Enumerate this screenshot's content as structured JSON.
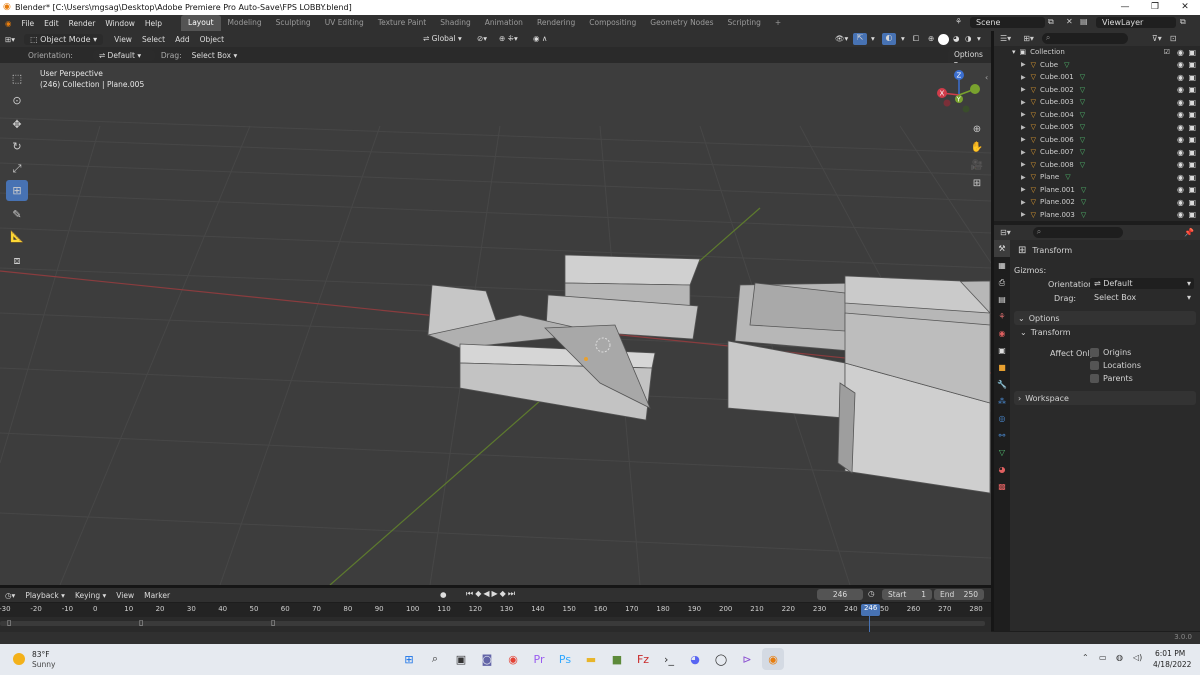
{
  "window": {
    "title": "Blender* [C:\\Users\\mgsag\\Desktop\\Adobe Premiere Pro Auto-Save\\FPS LOBBY.blend]"
  },
  "menu": {
    "items": [
      "File",
      "Edit",
      "Render",
      "Window",
      "Help"
    ]
  },
  "workspaces": [
    "Layout",
    "Modeling",
    "Sculpting",
    "UV Editing",
    "Texture Paint",
    "Shading",
    "Animation",
    "Rendering",
    "Compositing",
    "Geometry Nodes",
    "Scripting"
  ],
  "scene": {
    "label": "Scene",
    "view_layer": "ViewLayer"
  },
  "viewport_header": {
    "mode": "Object Mode",
    "view": "View",
    "select": "Select",
    "add": "Add",
    "object": "Object",
    "transform": "Global",
    "options": "Options"
  },
  "tool_header": {
    "orientation_label": "Orientation:",
    "orientation_value": "Default",
    "drag_label": "Drag:",
    "drag_value": "Select Box"
  },
  "viewport": {
    "perspective": "User Perspective",
    "info": "(246) Collection | Plane.005"
  },
  "gizmo": {
    "x": "X",
    "y": "Y",
    "z": "Z"
  },
  "outliner": {
    "collection": "Collection",
    "items": [
      "Cube",
      "Cube.001",
      "Cube.002",
      "Cube.003",
      "Cube.004",
      "Cube.005",
      "Cube.006",
      "Cube.007",
      "Cube.008",
      "Plane",
      "Plane.001",
      "Plane.002",
      "Plane.003"
    ]
  },
  "properties": {
    "section": "Transform",
    "gizmos": "Gizmos:",
    "orientation_label": "Orientation",
    "orientation_value": "Default",
    "drag_label": "Drag:",
    "drag_value": "Select Box",
    "options": "Options",
    "transform": "Transform",
    "affect_only": "Affect Only",
    "origins": "Origins",
    "locations": "Locations",
    "parents": "Parents",
    "workspace": "Workspace"
  },
  "timeline": {
    "playback": "Playback",
    "keying": "Keying",
    "view": "View",
    "marker": "Marker",
    "current_frame": "246",
    "start_label": "Start",
    "start": "1",
    "end_label": "End",
    "end": "250",
    "ticks": [
      "-30",
      "-20",
      "-10",
      "0",
      "10",
      "20",
      "30",
      "40",
      "50",
      "60",
      "70",
      "80",
      "90",
      "100",
      "110",
      "120",
      "130",
      "140",
      "150",
      "160",
      "170",
      "180",
      "190",
      "200",
      "210",
      "220",
      "230",
      "240",
      "250",
      "260",
      "270",
      "280"
    ]
  },
  "status": {
    "version": "3.0.0"
  },
  "taskbar": {
    "weather_temp": "83°F",
    "weather_desc": "Sunny",
    "time": "6:01 PM",
    "date": "4/18/2022"
  },
  "colors": {
    "accent": "#4772b3",
    "active_frame": "#4772b3",
    "grid_red": "#a0484a",
    "grid_green": "#6a8a36"
  }
}
